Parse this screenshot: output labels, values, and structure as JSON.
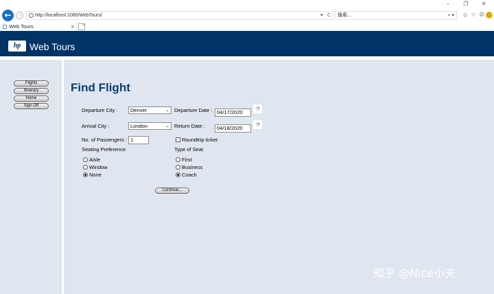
{
  "browser": {
    "window_controls": {
      "minimize": "–",
      "maximize": "❐",
      "close": "✕"
    },
    "back_icon": "back-arrow-icon",
    "forward_icon": "forward-arrow-icon",
    "address": "http://localhost:1080/WebTours/",
    "address_dropdown": "▾",
    "refresh_symbol": "C",
    "search_placeholder": "搜索...",
    "search_button": "⌕ ▾",
    "toolbar_icons": {
      "home": "⌂",
      "favorites": "☆",
      "settings": "⚙",
      "feedback": "☺"
    },
    "tab_title": "Web Tours",
    "tab_close": "×"
  },
  "header": {
    "logo": "hp",
    "brand": "Web Tours",
    "color": "#003366"
  },
  "sidebar": {
    "nav": [
      {
        "label": "Flights"
      },
      {
        "label": "Itinerary"
      },
      {
        "label": "Home"
      },
      {
        "label": "Sign Off"
      }
    ]
  },
  "form": {
    "title": "Find Flight",
    "departure_city_label": "Departure City :",
    "departure_city_value": "Denver",
    "departure_date_label": "Departure Date :",
    "departure_date_value": "04/17/2020",
    "arrival_city_label": "Arrival City :",
    "arrival_city_value": "London",
    "return_date_label": "Return Date :",
    "return_date_value": "04/18/2020",
    "passengers_label": "No. of Passengers :",
    "passengers_value": "1",
    "roundtrip_label": "Roundtrip ticket",
    "roundtrip_checked": false,
    "seating_pref_label": "Seating Preference",
    "seating_options": [
      {
        "label": "Aisle",
        "checked": false
      },
      {
        "label": "Window",
        "checked": false
      },
      {
        "label": "None",
        "checked": true
      }
    ],
    "seat_type_label": "Type of Seat",
    "seat_types": [
      {
        "label": "First",
        "checked": false
      },
      {
        "label": "Business",
        "checked": false
      },
      {
        "label": "Coach",
        "checked": true
      }
    ],
    "continue_label": "Continue...",
    "calendar_icon": "calendar-icon"
  },
  "watermark": "知乎 @Nice小夫",
  "colors": {
    "page_bg": "#e0e6f0",
    "title": "#0b3d73",
    "header": "#003366"
  }
}
